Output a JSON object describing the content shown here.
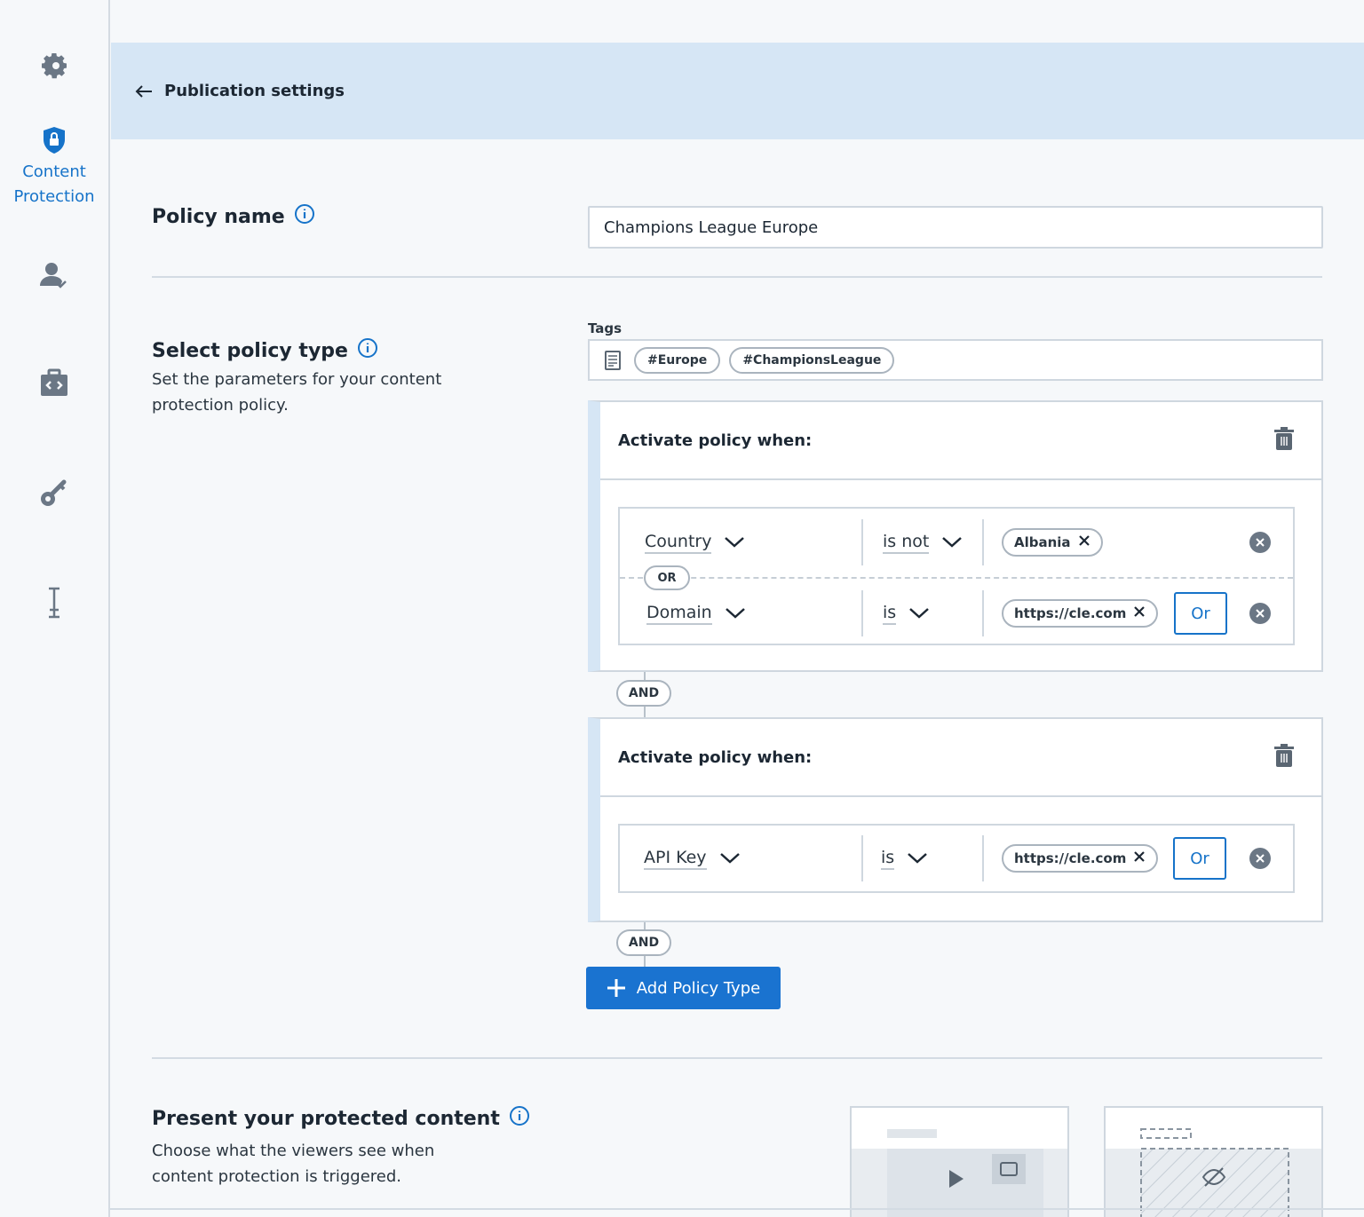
{
  "sidebar": {
    "items": [
      {
        "icon": "gear-icon"
      },
      {
        "icon": "shield-lock-icon",
        "label": "Content Protection",
        "active": true
      },
      {
        "icon": "user-check-icon"
      },
      {
        "icon": "code-briefcase-icon"
      },
      {
        "icon": "key-icon"
      },
      {
        "icon": "text-cursor-icon"
      }
    ]
  },
  "header": {
    "title": "Publication settings"
  },
  "policy_name": {
    "label": "Policy name",
    "value": "Champions League Europe"
  },
  "policy_type": {
    "label": "Select policy type",
    "description": "Set the parameters for your content protection policy.",
    "tags_label": "Tags",
    "tags": [
      "#Europe",
      "#ChampionsLeague"
    ],
    "cards": [
      {
        "title": "Activate policy when:",
        "rules": [
          {
            "field": "Country",
            "operator": "is not",
            "value": "Albania"
          },
          {
            "field": "Domain",
            "operator": "is",
            "value": "https://cle.com",
            "or_label": "Or"
          }
        ],
        "or_separator": "OR"
      },
      {
        "title": "Activate policy when:",
        "rules": [
          {
            "field": "API Key",
            "operator": "is",
            "value": "https://cle.com",
            "or_label": "Or"
          }
        ]
      }
    ],
    "and_label": "AND",
    "add_button": "Add Policy Type"
  },
  "present": {
    "label": "Present your protected content",
    "description": "Choose what the viewers see when content protection is triggered."
  },
  "colors": {
    "accent": "#1a73d0",
    "header_bg": "#d6e6f5",
    "page_bg": "#f6f8fa"
  }
}
